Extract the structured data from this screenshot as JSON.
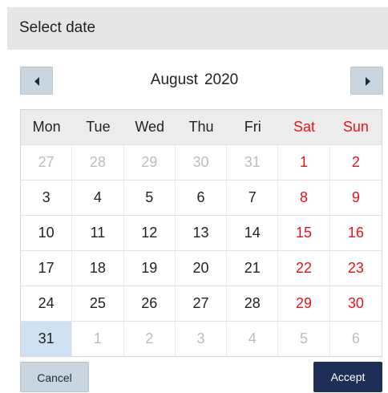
{
  "dialog": {
    "title": "Select date"
  },
  "nav": {
    "month": "August",
    "year": "2020"
  },
  "weekdays": [
    {
      "label": "Mon",
      "weekend": false
    },
    {
      "label": "Tue",
      "weekend": false
    },
    {
      "label": "Wed",
      "weekend": false
    },
    {
      "label": "Thu",
      "weekend": false
    },
    {
      "label": "Fri",
      "weekend": false
    },
    {
      "label": "Sat",
      "weekend": true
    },
    {
      "label": "Sun",
      "weekend": true
    }
  ],
  "weeks": [
    [
      "27",
      "28",
      "29",
      "30",
      "31",
      "1",
      "2"
    ],
    [
      "3",
      "4",
      "5",
      "6",
      "7",
      "8",
      "9"
    ],
    [
      "10",
      "11",
      "12",
      "13",
      "14",
      "15",
      "16"
    ],
    [
      "17",
      "18",
      "19",
      "20",
      "21",
      "22",
      "23"
    ],
    [
      "24",
      "25",
      "26",
      "27",
      "28",
      "29",
      "30"
    ],
    [
      "31",
      "1",
      "2",
      "3",
      "4",
      "5",
      "6"
    ]
  ],
  "out_of_month": [
    [
      true,
      true,
      true,
      true,
      true,
      false,
      false
    ],
    [
      false,
      false,
      false,
      false,
      false,
      false,
      false
    ],
    [
      false,
      false,
      false,
      false,
      false,
      false,
      false
    ],
    [
      false,
      false,
      false,
      false,
      false,
      false,
      false
    ],
    [
      false,
      false,
      false,
      false,
      false,
      false,
      false
    ],
    [
      false,
      true,
      true,
      true,
      true,
      true,
      true
    ]
  ],
  "selected": {
    "week": 5,
    "day": 0
  },
  "buttons": {
    "cancel": "Cancel",
    "accept": "Accept"
  },
  "colors": {
    "weekend": "#e8141b",
    "selected_bg": "#cfe0f2",
    "accent": "#1e2f57"
  }
}
